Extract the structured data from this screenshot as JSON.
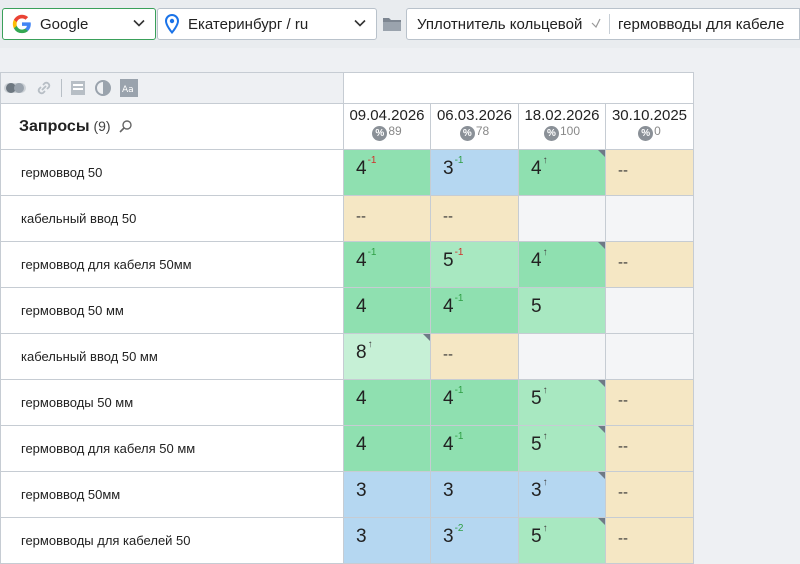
{
  "toolbar": {
    "engine": "Google",
    "region": "Екатеринбург / ru",
    "keyword_group_1": "Уплотнитель кольцевой",
    "keyword_group_2": "гермовводы для кабеле"
  },
  "table": {
    "header": {
      "title": "Запросы",
      "count": "(9)"
    },
    "dates": [
      {
        "date": "09.04.2026",
        "percent_icon": "%",
        "coverage": "89"
      },
      {
        "date": "06.03.2026",
        "percent_icon": "%",
        "coverage": "78"
      },
      {
        "date": "18.02.2026",
        "percent_icon": "%",
        "coverage": "100"
      },
      {
        "date": "30.10.2025",
        "percent_icon": "%",
        "coverage": "0"
      }
    ],
    "rows": [
      {
        "query": "гермоввод 50",
        "cells": [
          {
            "pos": "4",
            "chg": "-1",
            "dir": "down",
            "bg": "#8fe0b0"
          },
          {
            "pos": "3",
            "chg": "-1",
            "dir": "up",
            "bg": "#b5d7f1"
          },
          {
            "pos": "4",
            "chg": "↑",
            "dir": "new",
            "bg": "#8fe0b0",
            "flag": true
          },
          {
            "pos": "--",
            "chg": "",
            "dir": "",
            "bg": "#f5e7c4"
          }
        ]
      },
      {
        "query": "кабельный ввод 50",
        "cells": [
          {
            "pos": "--",
            "chg": "",
            "dir": "",
            "bg": "#f5e7c4"
          },
          {
            "pos": "--",
            "chg": "",
            "dir": "",
            "bg": "#f5e7c4"
          },
          {
            "pos": "",
            "chg": "",
            "dir": "",
            "bg": "#f4f5f7"
          },
          {
            "pos": "",
            "chg": "",
            "dir": "",
            "bg": "#f4f5f7"
          }
        ]
      },
      {
        "query": "гермоввод для кабеля 50мм",
        "cells": [
          {
            "pos": "4",
            "chg": "-1",
            "dir": "up",
            "bg": "#8fe0b0"
          },
          {
            "pos": "5",
            "chg": "-1",
            "dir": "down",
            "bg": "#a8e8c1"
          },
          {
            "pos": "4",
            "chg": "↑",
            "dir": "new",
            "bg": "#8fe0b0",
            "flag": true
          },
          {
            "pos": "--",
            "chg": "",
            "dir": "",
            "bg": "#f5e7c4"
          }
        ]
      },
      {
        "query": "гермоввод 50 мм",
        "cells": [
          {
            "pos": "4",
            "chg": "",
            "dir": "",
            "bg": "#8fe0b0"
          },
          {
            "pos": "4",
            "chg": "-1",
            "dir": "up",
            "bg": "#8fe0b0"
          },
          {
            "pos": "5",
            "chg": "",
            "dir": "",
            "bg": "#a8e8c1"
          },
          {
            "pos": "",
            "chg": "",
            "dir": "",
            "bg": "#f4f5f7"
          }
        ]
      },
      {
        "query": "кабельный ввод 50 мм",
        "cells": [
          {
            "pos": "8",
            "chg": "↑",
            "dir": "new",
            "bg": "#c6f0d6",
            "flag": true
          },
          {
            "pos": "--",
            "chg": "",
            "dir": "",
            "bg": "#f5e7c4"
          },
          {
            "pos": "",
            "chg": "",
            "dir": "",
            "bg": "#f4f5f7"
          },
          {
            "pos": "",
            "chg": "",
            "dir": "",
            "bg": "#f4f5f7"
          }
        ]
      },
      {
        "query": "гермовводы 50 мм",
        "cells": [
          {
            "pos": "4",
            "chg": "",
            "dir": "",
            "bg": "#8fe0b0"
          },
          {
            "pos": "4",
            "chg": "-1",
            "dir": "up",
            "bg": "#8fe0b0"
          },
          {
            "pos": "5",
            "chg": "↑",
            "dir": "new",
            "bg": "#a8e8c1",
            "flag": true
          },
          {
            "pos": "--",
            "chg": "",
            "dir": "",
            "bg": "#f5e7c4"
          }
        ]
      },
      {
        "query": "гермоввод для кабеля 50 мм",
        "cells": [
          {
            "pos": "4",
            "chg": "",
            "dir": "",
            "bg": "#8fe0b0"
          },
          {
            "pos": "4",
            "chg": "-1",
            "dir": "up",
            "bg": "#8fe0b0"
          },
          {
            "pos": "5",
            "chg": "↑",
            "dir": "new",
            "bg": "#a8e8c1",
            "flag": true
          },
          {
            "pos": "--",
            "chg": "",
            "dir": "",
            "bg": "#f5e7c4"
          }
        ]
      },
      {
        "query": "гермоввод 50мм",
        "cells": [
          {
            "pos": "3",
            "chg": "",
            "dir": "",
            "bg": "#b5d7f1"
          },
          {
            "pos": "3",
            "chg": "",
            "dir": "",
            "bg": "#b5d7f1"
          },
          {
            "pos": "3",
            "chg": "↑",
            "dir": "new",
            "bg": "#b5d7f1",
            "flag": true
          },
          {
            "pos": "--",
            "chg": "",
            "dir": "",
            "bg": "#f5e7c4"
          }
        ]
      },
      {
        "query": "гермовводы для кабелей 50",
        "cells": [
          {
            "pos": "3",
            "chg": "",
            "dir": "",
            "bg": "#b5d7f1"
          },
          {
            "pos": "3",
            "chg": "-2",
            "dir": "up",
            "bg": "#b5d7f1"
          },
          {
            "pos": "5",
            "chg": "↑",
            "dir": "new",
            "bg": "#a8e8c1",
            "flag": true
          },
          {
            "pos": "--",
            "chg": "",
            "dir": "",
            "bg": "#f5e7c4"
          }
        ]
      }
    ]
  }
}
